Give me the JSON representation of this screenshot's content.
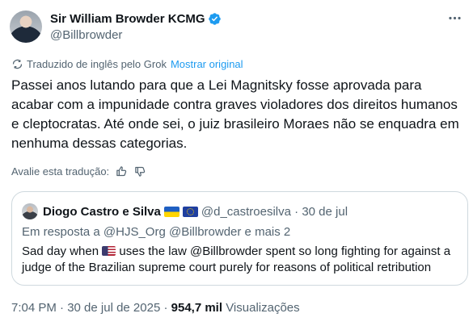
{
  "author": {
    "display_name": "Sir William Browder KCMG",
    "handle": "@Billbrowder"
  },
  "translation": {
    "notice": "Traduzido de inglês pelo Grok",
    "show_original": "Mostrar original",
    "rate_label": "Avalie esta tradução:"
  },
  "tweet": {
    "text": "Passei anos lutando para que a Lei Magnitsky fosse aprovada para acabar com a impunidade contra graves violadores dos direitos humanos e cleptocratas. Até onde sei, o juiz brasileiro Moraes não se enquadra em nenhuma dessas categorias."
  },
  "quote": {
    "display_name": "Diogo Castro e Silva",
    "flags": [
      "ukraine-flag",
      "eu-flag"
    ],
    "handle_date": "@d_castroesilva · 30 de jul",
    "reply_prefix": "Em resposta a",
    "reply_to": "@HJS_Org @Billbrowder e mais 2",
    "text_before_flag": "Sad day when",
    "text_after_flag": " uses the law @Billbrowder spent so long fighting for against a judge of the Brazilian supreme court purely for reasons of political retribution"
  },
  "meta": {
    "time_date": "7:04 PM · 30 de jul de 2025 ·",
    "views_count": "954,7 mil",
    "views_label": "Visualizações"
  },
  "colors": {
    "link": "#1d9bf0",
    "secondary_text": "#536471",
    "verified_badge": "#1d9bf0"
  }
}
